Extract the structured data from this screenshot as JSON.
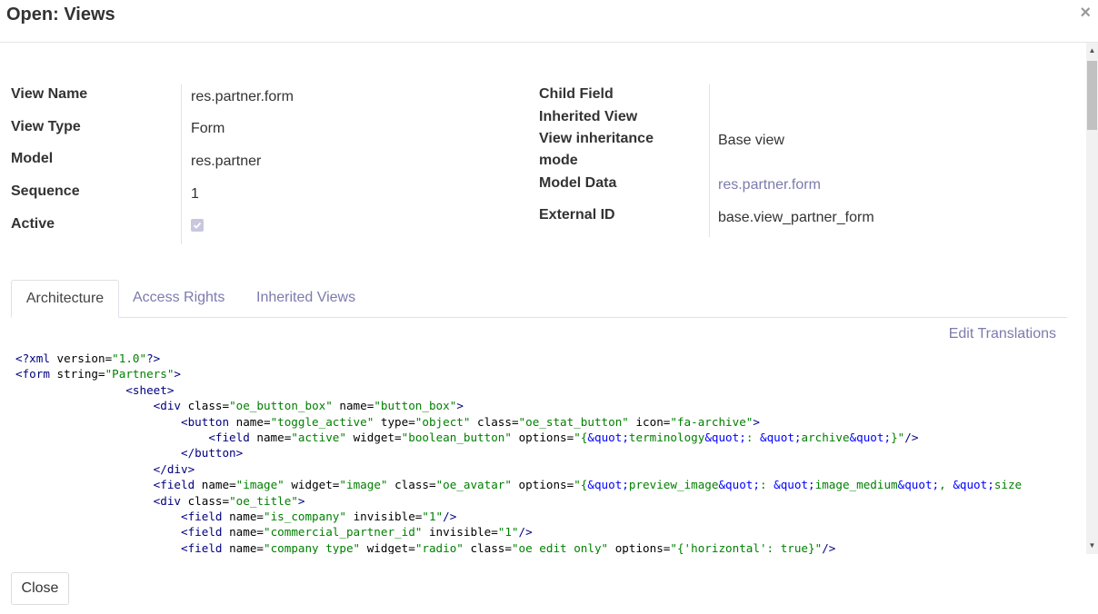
{
  "dialog": {
    "title": "Open: Views",
    "close_icon": "×"
  },
  "left_fields": [
    {
      "label": "View Name",
      "value": "res.partner.form"
    },
    {
      "label": "View Type",
      "value": "Form"
    },
    {
      "label": "Model",
      "value": "res.partner"
    },
    {
      "label": "Sequence",
      "value": "1"
    },
    {
      "label": "Active",
      "value": "checked"
    }
  ],
  "right_fields": {
    "child_field": {
      "label": "Child Field",
      "value": ""
    },
    "inherited_view": {
      "label": "Inherited View",
      "value": ""
    },
    "inheritance_mode": {
      "label_line1": "View inheritance",
      "label_line2": "mode",
      "value": "Base view"
    },
    "model_data": {
      "label": "Model Data",
      "value": "res.partner.form"
    },
    "external_id": {
      "label": "External ID",
      "value": "base.view_partner_form"
    }
  },
  "tabs": [
    {
      "label": "Architecture",
      "active": true
    },
    {
      "label": "Access Rights",
      "active": false
    },
    {
      "label": "Inherited Views",
      "active": false
    }
  ],
  "edit_translations": "Edit Translations",
  "code_lines": [
    {
      "indent": "",
      "segs": [
        [
          "t",
          "<?xml"
        ],
        [
          "",
          " version="
        ],
        [
          "s",
          "\"1.0\""
        ],
        [
          "t",
          "?>"
        ]
      ]
    },
    {
      "indent": "",
      "segs": [
        [
          "t",
          "<form"
        ],
        [
          "",
          " string="
        ],
        [
          "s",
          "\"Partners\""
        ],
        [
          "t",
          ">"
        ]
      ]
    },
    {
      "indent": "                ",
      "segs": [
        [
          "t",
          "<sheet>"
        ]
      ]
    },
    {
      "indent": "                    ",
      "segs": [
        [
          "t",
          "<div"
        ],
        [
          "",
          " class="
        ],
        [
          "s",
          "\"oe_button_box\""
        ],
        [
          "",
          " name="
        ],
        [
          "s",
          "\"button_box\""
        ],
        [
          "t",
          ">"
        ]
      ]
    },
    {
      "indent": "                        ",
      "segs": [
        [
          "t",
          "<button"
        ],
        [
          "",
          " name="
        ],
        [
          "s",
          "\"toggle_active\""
        ],
        [
          "",
          " type="
        ],
        [
          "s",
          "\"object\""
        ],
        [
          "",
          " class="
        ],
        [
          "s",
          "\"oe_stat_button\""
        ],
        [
          "",
          " icon="
        ],
        [
          "s",
          "\"fa-archive\""
        ],
        [
          "t",
          ">"
        ]
      ]
    },
    {
      "indent": "                            ",
      "segs": [
        [
          "t",
          "<field"
        ],
        [
          "",
          " name="
        ],
        [
          "s",
          "\"active\""
        ],
        [
          "",
          " widget="
        ],
        [
          "s",
          "\"boolean_button\""
        ],
        [
          "",
          " options="
        ],
        [
          "s",
          "\"{"
        ],
        [
          "e",
          "&quot;"
        ],
        [
          "s",
          "terminology"
        ],
        [
          "e",
          "&quot;"
        ],
        [
          "s",
          ": "
        ],
        [
          "e",
          "&quot;"
        ],
        [
          "s",
          "archive"
        ],
        [
          "e",
          "&quot;"
        ],
        [
          "s",
          "}\""
        ],
        [
          "t",
          "/>"
        ]
      ]
    },
    {
      "indent": "                        ",
      "segs": [
        [
          "t",
          "</button>"
        ]
      ]
    },
    {
      "indent": "                    ",
      "segs": [
        [
          "t",
          "</div>"
        ]
      ]
    },
    {
      "indent": "                    ",
      "segs": [
        [
          "t",
          "<field"
        ],
        [
          "",
          " name="
        ],
        [
          "s",
          "\"image\""
        ],
        [
          "",
          " widget="
        ],
        [
          "s",
          "\"image\""
        ],
        [
          "",
          " class="
        ],
        [
          "s",
          "\"oe_avatar\""
        ],
        [
          "",
          " options="
        ],
        [
          "s",
          "\"{"
        ],
        [
          "e",
          "&quot;"
        ],
        [
          "s",
          "preview_image"
        ],
        [
          "e",
          "&quot;"
        ],
        [
          "s",
          ": "
        ],
        [
          "e",
          "&quot;"
        ],
        [
          "s",
          "image_medium"
        ],
        [
          "e",
          "&quot;"
        ],
        [
          "s",
          ", "
        ],
        [
          "e",
          "&quot;"
        ],
        [
          "s",
          "size"
        ]
      ]
    },
    {
      "indent": "                    ",
      "segs": [
        [
          "t",
          "<div"
        ],
        [
          "",
          " class="
        ],
        [
          "s",
          "\"oe_title\""
        ],
        [
          "t",
          ">"
        ]
      ]
    },
    {
      "indent": "                        ",
      "segs": [
        [
          "t",
          "<field"
        ],
        [
          "",
          " name="
        ],
        [
          "s",
          "\"is_company\""
        ],
        [
          "",
          " invisible="
        ],
        [
          "s",
          "\"1\""
        ],
        [
          "t",
          "/>"
        ]
      ]
    },
    {
      "indent": "                        ",
      "segs": [
        [
          "t",
          "<field"
        ],
        [
          "",
          " name="
        ],
        [
          "s",
          "\"commercial_partner_id\""
        ],
        [
          "",
          " invisible="
        ],
        [
          "s",
          "\"1\""
        ],
        [
          "t",
          "/>"
        ]
      ]
    },
    {
      "indent": "                        ",
      "segs": [
        [
          "t",
          "<field"
        ],
        [
          "",
          " name="
        ],
        [
          "s",
          "\"company_type\""
        ],
        [
          "",
          " widget="
        ],
        [
          "s",
          "\"radio\""
        ],
        [
          "",
          " class="
        ],
        [
          "s",
          "\"oe_edit_only\""
        ],
        [
          "",
          " options="
        ],
        [
          "s",
          "\"{'horizontal': true}\""
        ],
        [
          "t",
          "/>"
        ]
      ]
    }
  ],
  "footer": {
    "close_label": "Close"
  },
  "icons": {
    "close": "close-icon",
    "checkbox": "checkmark-icon"
  },
  "colors": {
    "link": "#7c7bad",
    "tag": "#000080",
    "string": "#008000",
    "entity": "#0000ff"
  }
}
